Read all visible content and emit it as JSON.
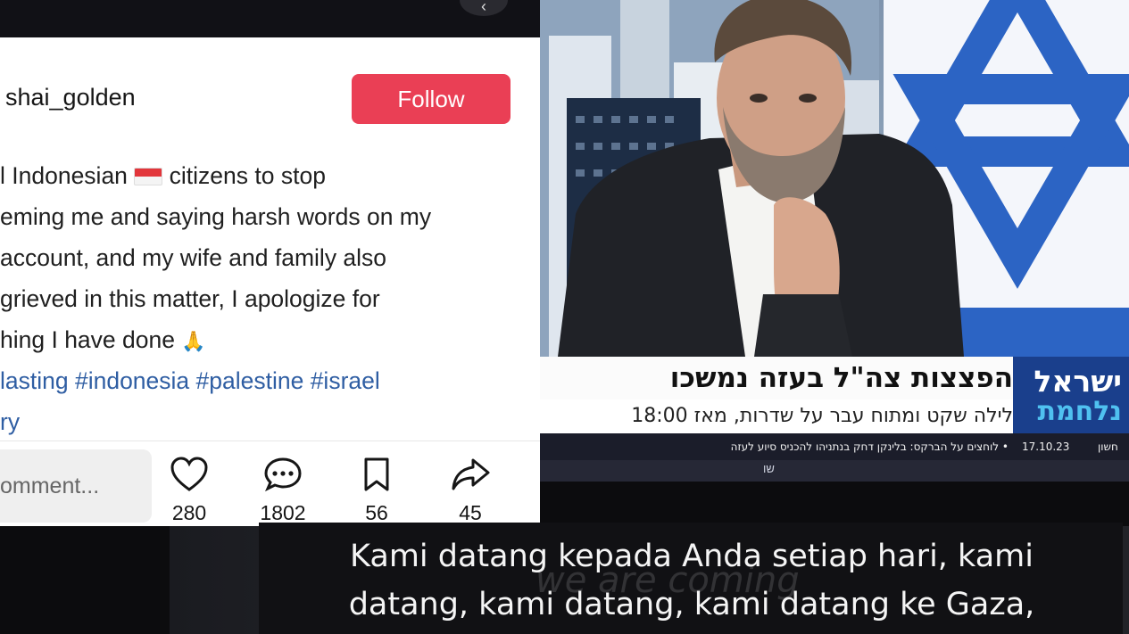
{
  "post": {
    "username": "shai_golden",
    "follow_label": "Follow",
    "caption_lines": [
      "l Indonesian",
      "citizens to stop",
      "eming me and saying harsh words on my",
      " account, and my wife and family also",
      "grieved in this matter, I apologize for",
      "hing I have done",
      "lasting #indonesia #palestine #israel",
      "ry"
    ],
    "comment_placeholder": "omment...",
    "actions": {
      "likes": "280",
      "comments": "1802",
      "saves": "56",
      "shares": "45"
    },
    "accent_color": "#ea3f55",
    "hashtag_color": "#2f5ea3"
  },
  "tv": {
    "headline": "הפצצות צה\"ל בעזה נמשכו",
    "subline": "לילה שקט ומתוח עבר על שדרות, מאז 18:00",
    "channel_top": "ישראל",
    "channel_bottom": "נלחמת",
    "ticker_text": "• לוחצים על הברקס: בלינקן דחק בנתניהו להכניס סיוע לעזה",
    "ticker_date": "17.10.23",
    "ticker_day": "חשון",
    "ticker_small": "שו"
  },
  "subtitle": {
    "line1": "Kami datang kepada Anda setiap hari, kami",
    "line2": "datang, kami datang, kami datang ke Gaza,",
    "watermark": "we are coming"
  }
}
